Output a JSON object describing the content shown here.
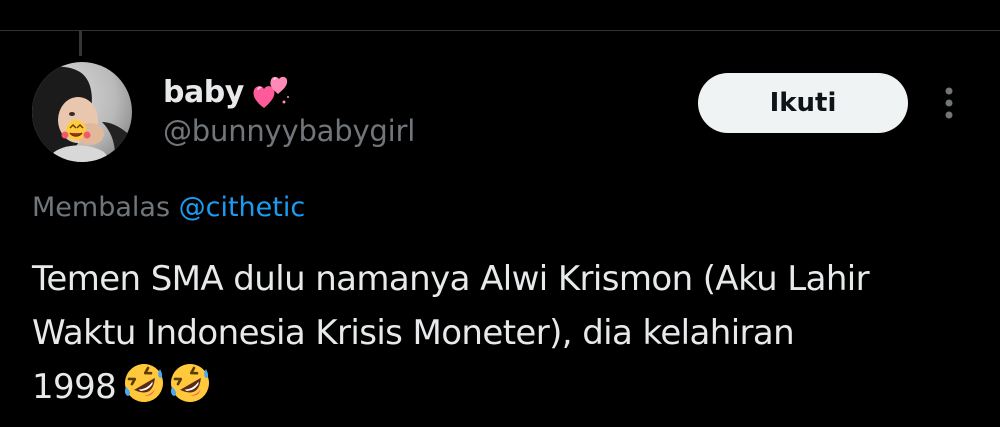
{
  "tweet": {
    "author": {
      "display_name": "baby",
      "name_emoji": "two-hearts-emoji",
      "username": "@bunnyybabygirl",
      "avatar": "avatar"
    },
    "follow_label": "Ikuti",
    "more_icon": "more-vertical-icon",
    "reply": {
      "prefix": "Membalas",
      "handle": "@cithetic"
    },
    "text_lines": [
      "Temen SMA dulu namanya Alwi Krismon (Aku Lahir",
      "Waktu Indonesia Krisis Moneter), dia kelahiran",
      "1998"
    ],
    "trailing_emojis": [
      "rolling-on-floor-laughing-emoji",
      "rolling-on-floor-laughing-emoji"
    ]
  },
  "colors": {
    "background": "#000000",
    "primary_text": "#e7e9ea",
    "secondary_text": "#71767b",
    "link": "#1d9bf0",
    "follow_button_bg": "#eff3f4",
    "follow_button_text": "#0f1419",
    "divider": "#2f3336"
  }
}
